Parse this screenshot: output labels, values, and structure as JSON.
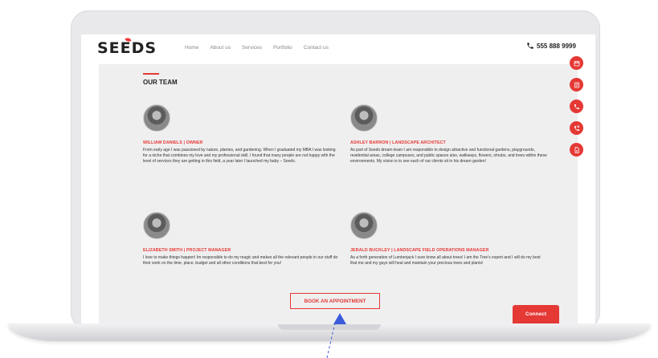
{
  "site": {
    "logo": "SEEDS",
    "nav": [
      "Home",
      "About us",
      "Services",
      "Portfolio",
      "Contact us"
    ],
    "phone": "555 888 9999"
  },
  "team": {
    "title": "OUR TEAM",
    "members": [
      {
        "name": "WILLIAM DANIELS | OWNER",
        "bio": "From early age I was passioned by nature, plantes, and gardening. When I graduated my MBA I was looking for a niche that combines my love and my professional skill. I found that many people are not happy with the level of services they are getting in this field, a year later I launched my baby – Seeds."
      },
      {
        "name": "ASHLEY BARRON | LANDSCAPE ARCHITECT",
        "bio": "As part of Seeds dream team I am responsible to design attractive and functional gardens, playgrounds, residential areas, college campuses, and public spaces also, walkways, flowers, shrubs, and trees within these environments. My vision is to see each of our clients sit in his dream garden!"
      },
      {
        "name": "ELIZABETH SMITH | PROJECT MANAGER",
        "bio": "I love to make things happen! Im responsible to do my magic and mekes all the relevant people in our stuff do their work on the time, place, budget and all other conditions that best for you!"
      },
      {
        "name": "JERALD BUCKLEY | LANDSCAPE FIELD OPERATIONS MANAGER",
        "bio": "As a forth generation of Lumberjack I sure know all about trees! I am the Tree's expert and I will do my best that me and my guys will heal and maintain your precious trees and plants!"
      }
    ]
  },
  "buttons": {
    "book": "BOOK AN APPOINTMENT",
    "connect": "Connect"
  },
  "side_icons": [
    "calendar-icon",
    "document-icon",
    "phone-icon",
    "phone-callback-icon",
    "file-icon"
  ],
  "colors": {
    "accent": "#e53935",
    "content_bg": "#efeff0"
  }
}
